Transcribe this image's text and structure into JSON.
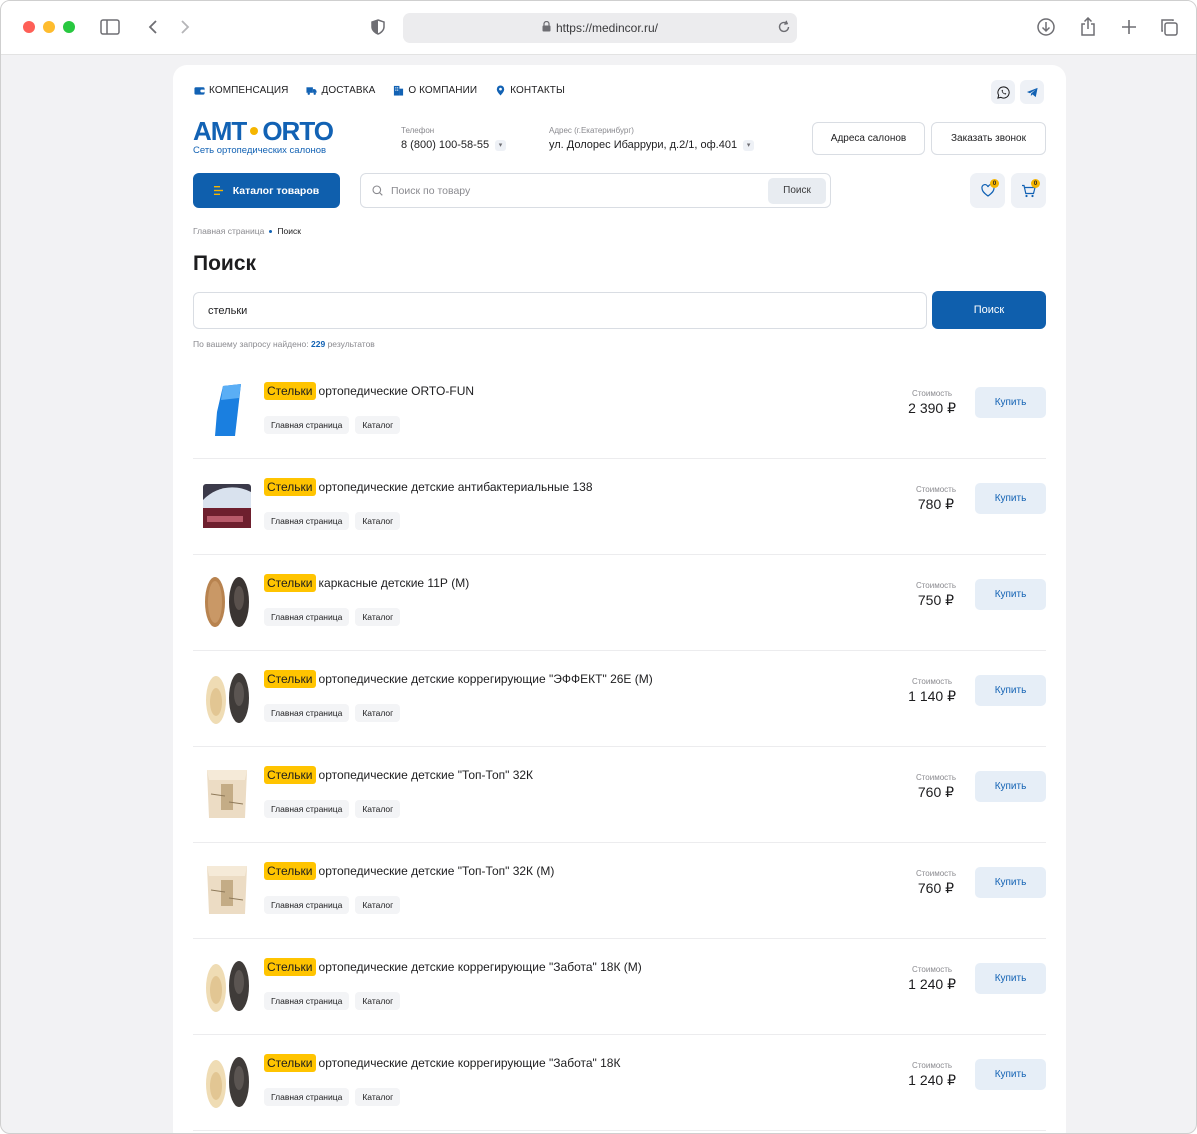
{
  "browser": {
    "url": "https://medincor.ru/"
  },
  "topnav": [
    {
      "label": "КОМПЕНСАЦИЯ",
      "icon": "wallet-icon"
    },
    {
      "label": "ДОСТАВКА",
      "icon": "truck-icon"
    },
    {
      "label": "О КОМПАНИИ",
      "icon": "building-icon"
    },
    {
      "label": "КОНТАКТЫ",
      "icon": "pin-icon"
    }
  ],
  "logo": {
    "left": "АМТ",
    "right": "ORTO",
    "sub": "Сеть ортопедических салонов"
  },
  "phone": {
    "label": "Телефон",
    "value": "8 (800) 100-58-55"
  },
  "address": {
    "label": "Адрес (г.Екатеринбург)",
    "value": "ул. Долорес Ибаррури, д.2/1, оф.401"
  },
  "header_buttons": {
    "salons": "Адреса салонов",
    "callback": "Заказать звонок"
  },
  "catalog_label": "Каталог товаров",
  "top_search": {
    "placeholder": "Поиск по товару",
    "button": "Поиск"
  },
  "badges": {
    "favorites": "0",
    "cart": "0"
  },
  "breadcrumbs": {
    "home": "Главная страница",
    "current": "Поиск"
  },
  "page_title": "Поиск",
  "main_search": {
    "value": "стельки",
    "button": "Поиск"
  },
  "result_count": {
    "prefix": "По вашему запросу найдено:",
    "count": "229",
    "suffix": "результатов"
  },
  "price_label": "Стоимость",
  "buy_label": "Купить",
  "tag_home": "Главная страница",
  "tag_catalog": "Каталог",
  "results": [
    {
      "highlight": "Стельки",
      "rest": "ортопедические ORTO-FUN",
      "price": "2 390 ₽",
      "thumb": "blue"
    },
    {
      "highlight": "Стельки",
      "rest": "ортопедические детские антибактериальные 138",
      "price": "780 ₽",
      "thumb": "photo"
    },
    {
      "highlight": "Стельки",
      "rest": "каркасные детские 11Р (М)",
      "price": "750 ₽",
      "thumb": "cork"
    },
    {
      "highlight": "Стельки",
      "rest": "ортопедические детские коррегирующие \"ЭФФЕКТ\" 26Е (М)",
      "price": "1 140 ₽",
      "thumb": "beige"
    },
    {
      "highlight": "Стельки",
      "rest": "ортопедические детские \"Топ-Топ\" 32К",
      "price": "760 ₽",
      "thumb": "box"
    },
    {
      "highlight": "Стельки",
      "rest": "ортопедические детские \"Топ-Топ\" 32К (М)",
      "price": "760 ₽",
      "thumb": "box"
    },
    {
      "highlight": "Стельки",
      "rest": "ортопедические детские коррегирующие \"Забота\" 18К (М)",
      "price": "1 240 ₽",
      "thumb": "beige"
    },
    {
      "highlight": "Стельки",
      "rest": "ортопедические детские коррегирующие \"Забота\" 18К",
      "price": "1 240 ₽",
      "thumb": "beige"
    }
  ]
}
